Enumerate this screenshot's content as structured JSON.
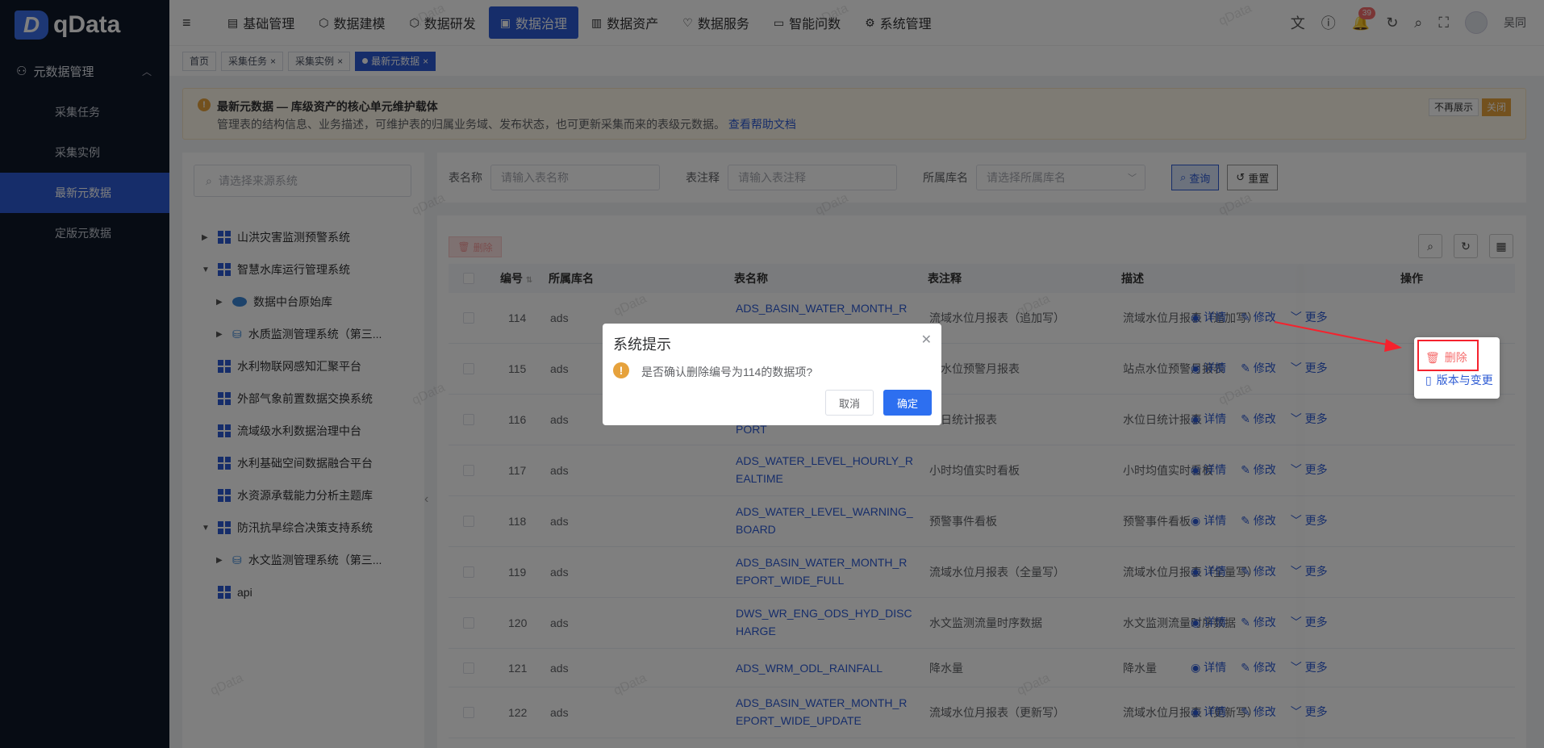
{
  "app": {
    "logo_text": "qData",
    "logo_letter": "D"
  },
  "sidebar": {
    "group": "元数据管理",
    "items": [
      {
        "label": "采集任务",
        "active": false
      },
      {
        "label": "采集实例",
        "active": false
      },
      {
        "label": "最新元数据",
        "active": true
      },
      {
        "label": "定版元数据",
        "active": false
      }
    ]
  },
  "nav": [
    {
      "label": "基础管理",
      "icon": "building-icon"
    },
    {
      "label": "数据建模",
      "icon": "cube-icon"
    },
    {
      "label": "数据研发",
      "icon": "hexagon-icon"
    },
    {
      "label": "数据治理",
      "icon": "govern-icon",
      "active": true
    },
    {
      "label": "数据资产",
      "icon": "asset-icon"
    },
    {
      "label": "数据服务",
      "icon": "service-icon"
    },
    {
      "label": "智能问数",
      "icon": "robot-icon"
    },
    {
      "label": "系统管理",
      "icon": "settings-icon"
    }
  ],
  "header": {
    "notification_count": "39",
    "username": "吴同"
  },
  "tabs": [
    {
      "label": "首页"
    },
    {
      "label": "采集任务"
    },
    {
      "label": "采集实例"
    },
    {
      "label": "最新元数据",
      "active": true
    }
  ],
  "notice": {
    "title": "最新元数据 — 库级资产的核心单元维护载体",
    "desc": "管理表的结构信息、业务描述，可维护表的归属业务域、发布状态，也可更新采集而来的表级元数据。",
    "link": "查看帮助文档",
    "hide_btn": "不再展示",
    "close_btn": "关闭"
  },
  "tree": {
    "search_placeholder": "请选择来源系统",
    "nodes": [
      {
        "label": "山洪灾害监测预警系统"
      },
      {
        "label": "智慧水库运行管理系统"
      },
      {
        "label": "数据中台原始库"
      },
      {
        "label": "水质监测管理系统（第三..."
      },
      {
        "label": "水利物联网感知汇聚平台"
      },
      {
        "label": "外部气象前置数据交换系统"
      },
      {
        "label": "流域级水利数据治理中台"
      },
      {
        "label": "水利基础空间数据融合平台"
      },
      {
        "label": "水资源承载能力分析主题库"
      },
      {
        "label": "防汛抗旱综合决策支持系统"
      },
      {
        "label": "水文监测管理系统（第三..."
      },
      {
        "label": "api"
      }
    ]
  },
  "filter": {
    "table_name_label": "表名称",
    "table_name_placeholder": "请输入表名称",
    "comment_label": "表注释",
    "comment_placeholder": "请输入表注释",
    "db_label": "所属库名",
    "db_placeholder": "请选择所属库名",
    "query_btn": "查询",
    "reset_btn": "重置"
  },
  "table": {
    "delete_btn": "删除",
    "columns": [
      "编号",
      "所属库名",
      "表名称",
      "表注释",
      "描述",
      "操作"
    ],
    "rows": [
      {
        "id": "114",
        "db": "ads",
        "name": "ADS_BASIN_WATER_MONTH_R",
        "comment": "流域水位月报表（追加写）",
        "desc": "流域水位月报表（追加写）"
      },
      {
        "id": "115",
        "db": "ads",
        "name": "",
        "comment": "点水位预警月报表",
        "desc": "站点水位预警月报表"
      },
      {
        "id": "116",
        "db": "ads",
        "name": "PORT",
        "comment": "位日统计报表",
        "desc": "水位日统计报表"
      },
      {
        "id": "117",
        "db": "ads",
        "name": "ADS_WATER_LEVEL_HOURLY_REALTIME",
        "comment": "小时均值实时看板",
        "desc": "小时均值实时看板"
      },
      {
        "id": "118",
        "db": "ads",
        "name": "ADS_WATER_LEVEL_WARNING_BOARD",
        "comment": "预警事件看板",
        "desc": "预警事件看板"
      },
      {
        "id": "119",
        "db": "ads",
        "name": "ADS_BASIN_WATER_MONTH_REPORT_WIDE_FULL",
        "comment": "流域水位月报表（全量写）",
        "desc": "流域水位月报表（全量写）"
      },
      {
        "id": "120",
        "db": "ads",
        "name": "DWS_WR_ENG_ODS_HYD_DISCHARGE",
        "comment": "水文监测流量时序数据",
        "desc": "水文监测流量时序数据"
      },
      {
        "id": "121",
        "db": "ads",
        "name": "ADS_WRM_ODL_RAINFALL",
        "comment": "降水量",
        "desc": "降水量"
      },
      {
        "id": "122",
        "db": "ads",
        "name": "ADS_BASIN_WATER_MONTH_REPORT_WIDE_UPDATE",
        "comment": "流域水位月报表（更新写）",
        "desc": "流域水位月报表（更新写）"
      }
    ],
    "op_detail": "详情",
    "op_edit": "修改",
    "op_more": "更多"
  },
  "dropdown": {
    "delete": "删除",
    "version": "版本与变更"
  },
  "dialog": {
    "title": "系统提示",
    "message": "是否确认删除编号为114的数据项?",
    "cancel": "取消",
    "confirm": "确定"
  },
  "watermark": "qData",
  "colors": {
    "primary": "#2d5bd4",
    "sidebar_bg": "#0f1929",
    "danger": "#f56c6c",
    "warning": "#e6a23c"
  }
}
